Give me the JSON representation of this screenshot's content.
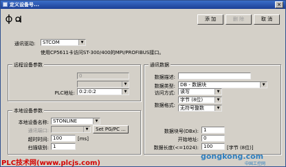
{
  "window": {
    "title": "定义设备号...",
    "close_glyph": "×"
  },
  "buttons": {
    "add": "添 加",
    "delete": "删 除",
    "cancel": "取 消"
  },
  "comm": {
    "driver_label": "通讯驱动:",
    "driver_value": "STCOM",
    "hint": "使用CP5611卡访问ST-300/400的MPI/PROFIBUS接口。"
  },
  "remote": {
    "title": "远程设备参数",
    "field1": "0",
    "field2": "",
    "plc_addr_label": "PLC地址:",
    "plc_addr_value": "0:2:0:2"
  },
  "local": {
    "title": "本地设备参数",
    "device_name_label": "本地设备名称:",
    "device_name_value": "STONLINE",
    "port_label": "通讯端口:",
    "port_value": "",
    "setpg_label": "Set PG/PC ...",
    "timeout_label": "超时时间:",
    "timeout_value": "100",
    "timeout_unit": "[ms]",
    "scan_label": "扫描级别:",
    "scan_value": "1"
  },
  "data": {
    "title": "通讯数据",
    "desc_label": "数据描述:",
    "desc_value": "",
    "type_label": "数据类型:",
    "type_value": "DB - 数据块",
    "access_label": "访问方式:",
    "access_value": "读写",
    "format_label": "数据格式:",
    "format_value1": "字节 (8位)",
    "format_value2": "无符号整数",
    "block_label": "数据块号(DBx):",
    "block_value": "1",
    "start_label": "开始地址:",
    "start_value": "0",
    "length_label": "数据长度(<=1024):",
    "length_value": "100",
    "length_unit": "[字节 (8位)]"
  },
  "watermarks": {
    "left": "PLC技术网(www.plcjs.com)",
    "right": "gongkong.com",
    "right_cn": "中国工控网",
    "left_color": "#d40000",
    "right_color": "#2f7fbf"
  }
}
